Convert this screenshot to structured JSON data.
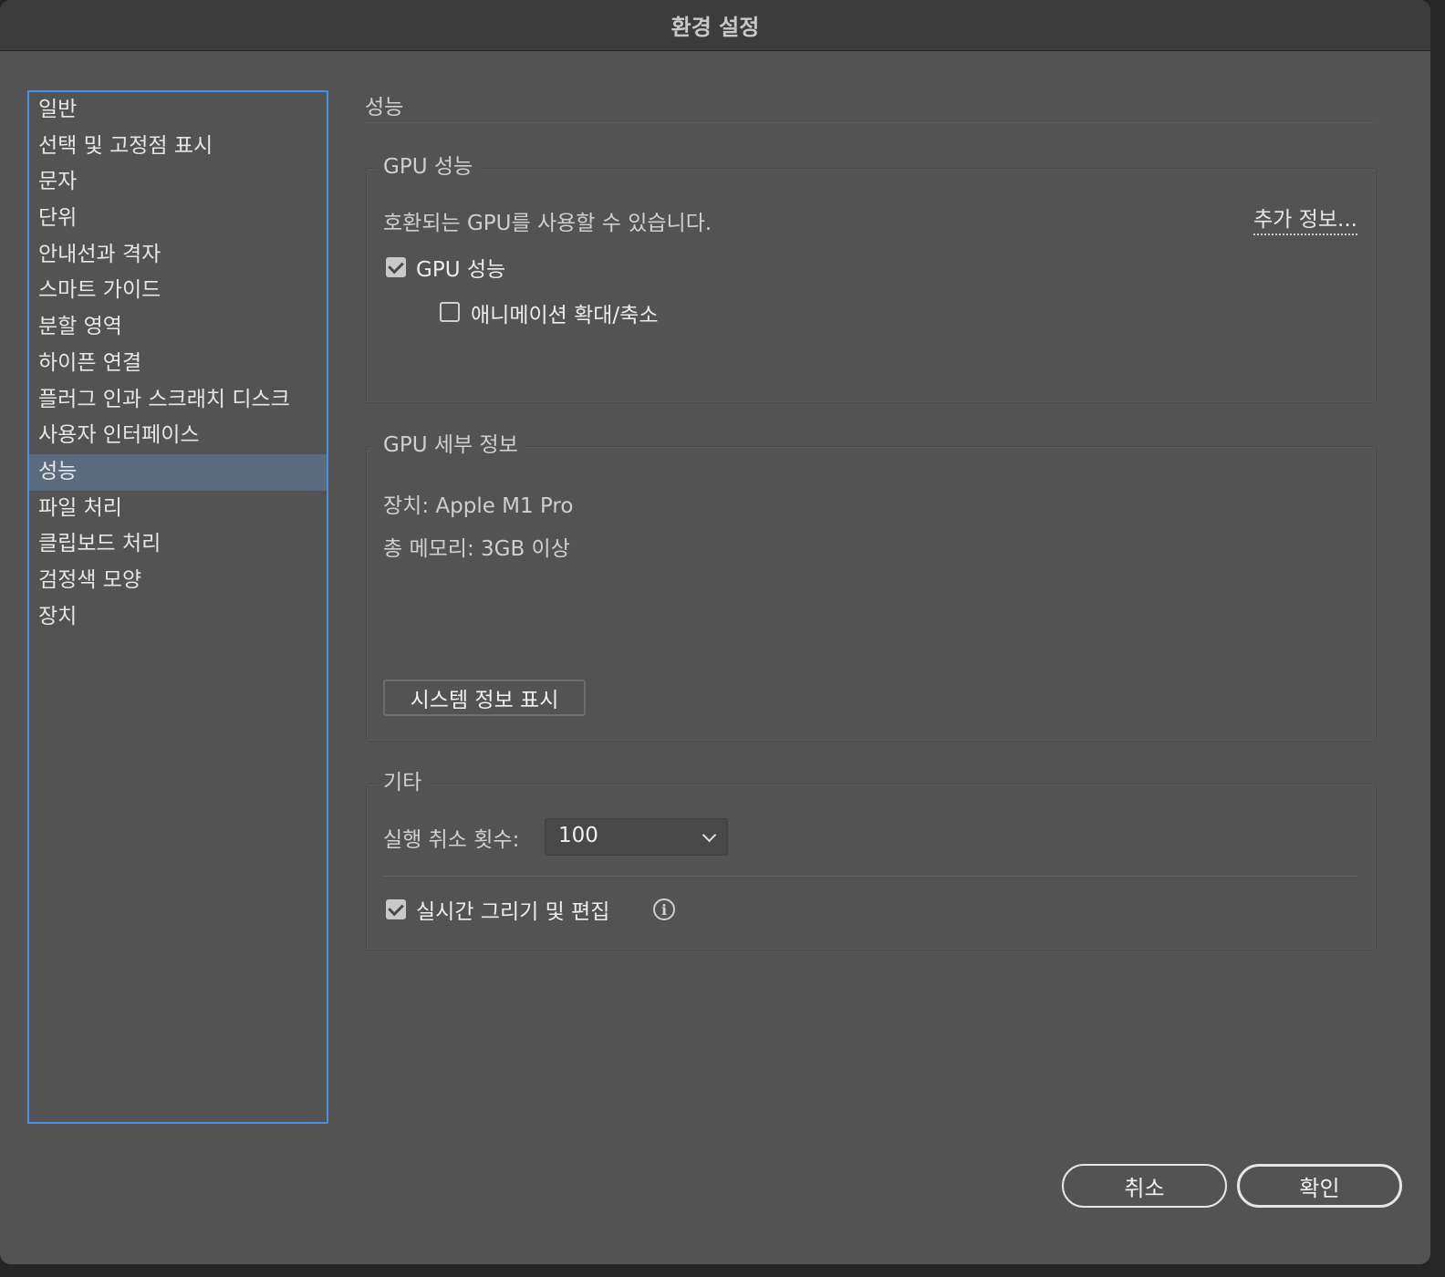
{
  "window": {
    "title": "환경 설정"
  },
  "sidebar": {
    "items": [
      {
        "label": "일반"
      },
      {
        "label": "선택 및 고정점 표시"
      },
      {
        "label": "문자"
      },
      {
        "label": "단위"
      },
      {
        "label": "안내선과 격자"
      },
      {
        "label": "스마트 가이드"
      },
      {
        "label": "분할 영역"
      },
      {
        "label": "하이픈 연결"
      },
      {
        "label": "플러그 인과 스크래치 디스크"
      },
      {
        "label": "사용자 인터페이스"
      },
      {
        "label": "성능"
      },
      {
        "label": "파일 처리"
      },
      {
        "label": "클립보드 처리"
      },
      {
        "label": "검정색 모양"
      },
      {
        "label": "장치"
      }
    ],
    "selected": "성능"
  },
  "main": {
    "section_title": "성능",
    "gpu_performance": {
      "legend": "GPU 성능",
      "compat_text": "호환되는 GPU를 사용할 수 있습니다.",
      "more_info_link": "추가 정보...",
      "gpu_checkbox_label": "GPU 성능",
      "gpu_checked": true,
      "animated_zoom_label": "애니메이션 확대/축소",
      "animated_zoom_checked": false
    },
    "gpu_details": {
      "legend": "GPU 세부 정보",
      "device": "장치: Apple M1 Pro",
      "memory": "총 메모리:  3GB 이상",
      "system_info_button": "시스템 정보 표시"
    },
    "misc": {
      "legend": "기타",
      "undo_label": "실행 취소 횟수:",
      "undo_value": "100",
      "realtime_label": "실시간 그리기 및 편집",
      "realtime_checked": true,
      "info_icon": "info-icon"
    }
  },
  "footer": {
    "cancel_label": "취소",
    "ok_label": "확인"
  }
}
